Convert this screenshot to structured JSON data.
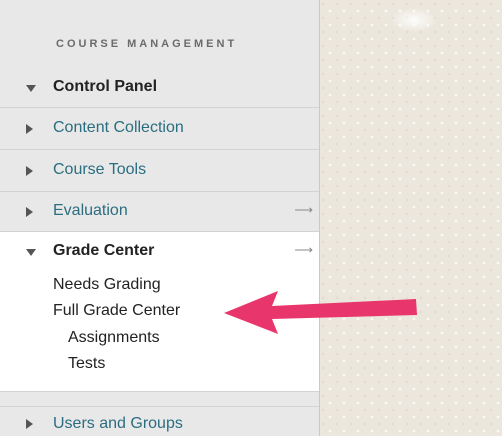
{
  "sidebar": {
    "section_title": "COURSE MANAGEMENT",
    "control_panel": {
      "label": "Control Panel"
    },
    "items": [
      {
        "label": "Content Collection"
      },
      {
        "label": "Course Tools"
      },
      {
        "label": "Evaluation"
      }
    ],
    "grade_center": {
      "label": "Grade Center",
      "links": {
        "needs_grading": "Needs Grading",
        "full_grade_center": "Full Grade Center",
        "assignments": "Assignments",
        "tests": "Tests"
      }
    },
    "users_and_groups": {
      "label": "Users and Groups"
    }
  },
  "icons": {
    "expanded": "triangle-down-icon",
    "collapsed": "triangle-right-icon",
    "go": "arrow-right-icon",
    "callout": "pointer-arrow-icon"
  },
  "colors": {
    "link": "#2a6e80",
    "sidebar_bg": "#e8e8e8",
    "active_panel_bg": "#ffffff",
    "callout_arrow": "#e8356b"
  }
}
